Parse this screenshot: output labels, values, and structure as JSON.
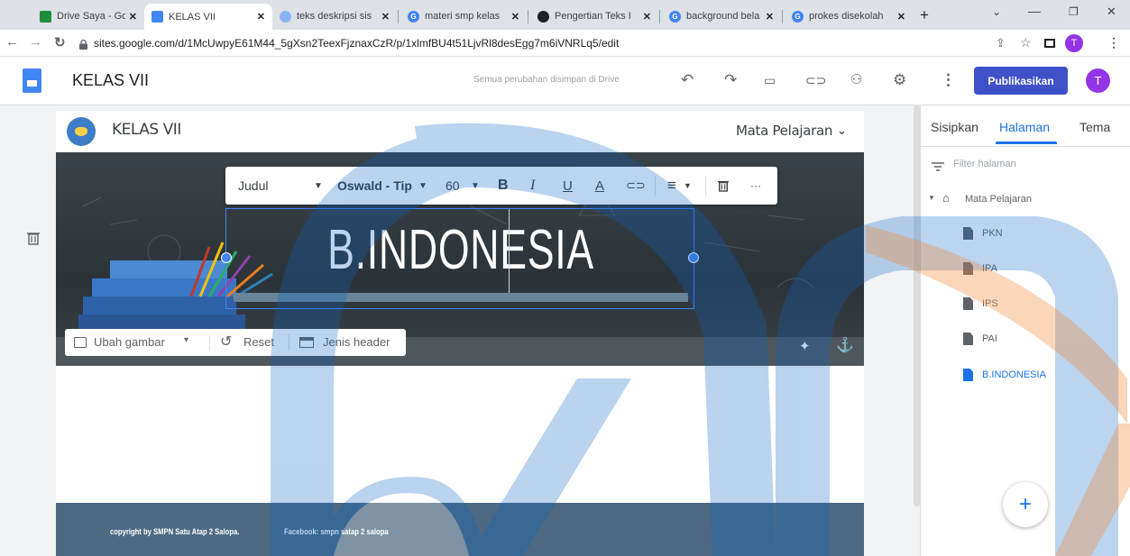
{
  "browser": {
    "tabs": [
      {
        "title": "Drive Saya - Goo",
        "color": "#1e8e3e"
      },
      {
        "title": "KELAS VII",
        "color": "#4285f4"
      },
      {
        "title": "teks deskripsi sis",
        "color": "#4285f4"
      },
      {
        "title": "materi smp kelas",
        "color": "#4285f4"
      },
      {
        "title": "Pengertian Teks I",
        "color": "#202124"
      },
      {
        "title": "background bela",
        "color": "#4285f4"
      },
      {
        "title": "prokes disekolah",
        "color": "#4285f4"
      }
    ],
    "new_tab": "+",
    "url": "sites.google.com/d/1McUwpyE61M44_5gXsn2TeexFjznaxCzR/p/1xlmfBU4t51LjvRl8desEgg7m6iVNRLq5/edit",
    "profile_initial": "T"
  },
  "sites_header": {
    "title": "KELAS VII",
    "save_status": "Semua perubahan disimpan di Drive",
    "publish_label": "Publikasikan",
    "avatar_initial": "T"
  },
  "page": {
    "site_title": "KELAS VII",
    "nav_dropdown": "Mata Pelajaran",
    "hero_title": "B.INDONESIA",
    "hero_buttons": {
      "change_image": "Ubah gambar",
      "reset": "Reset",
      "header_type": "Jenis header"
    },
    "footer_copyright": "copyright by SMPN Satu Atap 2 Salopa.",
    "footer_facebook": "Facebook: smpn satap 2 salopa"
  },
  "format_toolbar": {
    "style": "Judul",
    "font": "Oswald - Tip",
    "size": "60",
    "bold": "B",
    "italic": "I",
    "underline": "U",
    "text_color": "A",
    "more": "···"
  },
  "panel": {
    "tabs": [
      "Sisipkan",
      "Halaman",
      "Tema"
    ],
    "active_tab": "Halaman",
    "filter_placeholder": "Filter halaman",
    "root": "Mata Pelajaran",
    "pages": [
      "PKN",
      "IPA",
      "IPS",
      "PAI",
      "B.INDONESIA"
    ],
    "active_page": "B.INDONESIA",
    "add_button": "+"
  },
  "colors": {
    "accent": "#1a73e8",
    "publish_bg": "#3f51c8",
    "avatar_bg": "#9334e6",
    "footer_bg": "#4d6a82"
  }
}
